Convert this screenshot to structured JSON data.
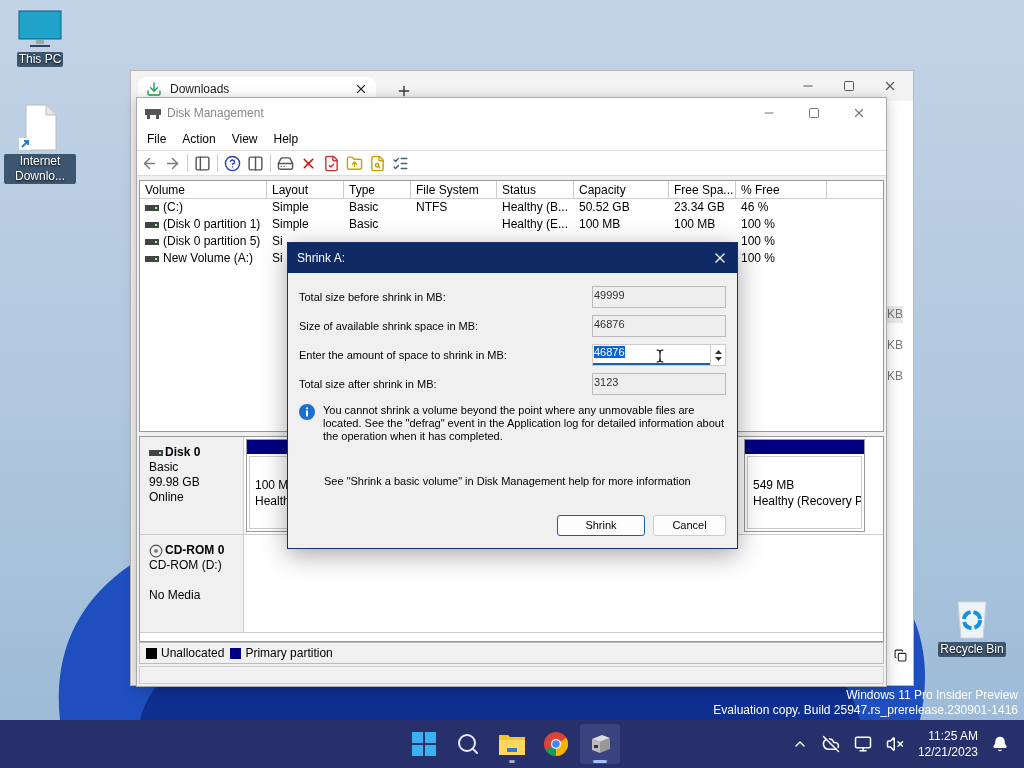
{
  "desktop_icons": [
    {
      "kind": "pc",
      "label": "This PC"
    },
    {
      "kind": "shortcut",
      "label": "Internet Downlo..."
    },
    {
      "kind": "bin",
      "label": "Recycle Bin"
    }
  ],
  "browser": {
    "tab": {
      "title": "Downloads",
      "selected": true
    },
    "side_texts": [
      "KB",
      "KB",
      "KB"
    ]
  },
  "disk_management": {
    "title": "Disk Management",
    "menu": [
      "File",
      "Action",
      "View",
      "Help"
    ],
    "columns": [
      "Volume",
      "Layout",
      "Type",
      "File System",
      "Status",
      "Capacity",
      "Free Spa...",
      "% Free"
    ],
    "rows": [
      {
        "cells": [
          "(C:)",
          "Simple",
          "Basic",
          "NTFS",
          "Healthy (B...",
          "50.52 GB",
          "23.34 GB",
          "46 %"
        ]
      },
      {
        "cells": [
          "(Disk 0 partition 1)",
          "Simple",
          "Basic",
          null,
          "Healthy (E...",
          "100 MB",
          "100 MB",
          "100 %"
        ]
      },
      {
        "cells": [
          "(Disk 0 partition 5)",
          "Si",
          null,
          null,
          null,
          null,
          null,
          "100 %"
        ]
      },
      {
        "cells": [
          "New Volume (A:)",
          "Si",
          null,
          null,
          null,
          null,
          null,
          "100 %"
        ]
      }
    ],
    "disks": [
      {
        "kind": "disk",
        "name": "Disk 0",
        "lines": [
          "Basic",
          "99.98 GB",
          "Online"
        ],
        "partitions": [
          {
            "size": "100 M",
            "status": "Health"
          },
          {
            "size": "549 MB",
            "status": "Healthy (Recovery P"
          }
        ]
      },
      {
        "kind": "cdrom",
        "name": "CD-ROM 0",
        "lines": [
          "CD-ROM (D:)",
          "No Media"
        ]
      }
    ],
    "legend": [
      {
        "label": "Unallocated",
        "color": "#000000"
      },
      {
        "label": "Primary partition",
        "color": "#000080"
      }
    ]
  },
  "dialog": {
    "title": "Shrink A:",
    "fields": [
      {
        "kind": "readonly",
        "label": "Total size before shrink in MB:",
        "value": "49999"
      },
      {
        "kind": "readonly",
        "label": "Size of available shrink space in MB:",
        "value": "46876"
      },
      {
        "kind": "spin",
        "label": "Enter the amount of space to shrink in MB:",
        "value": "46876",
        "selected": true
      },
      {
        "kind": "readonly",
        "label": "Total size after shrink in MB:",
        "value": "3123"
      }
    ],
    "info": "You cannot shrink a volume beyond the point where any unmovable files are located. See the \"defrag\" event in the Application log for detailed information about the operation when it has completed.",
    "help": "See \"Shrink a basic volume\" in Disk Management help for more information",
    "buttons": [
      {
        "label": "Shrink",
        "default": true
      },
      {
        "label": "Cancel",
        "default": false
      }
    ]
  },
  "watermark": [
    "Windows 11 Pro Insider Preview",
    "Evaluation copy. Build 25947.rs_prerelease.230901-1416"
  ],
  "taskbar": {
    "apps": [
      {
        "kind": "start",
        "running": false,
        "selected": false
      },
      {
        "kind": "search",
        "running": false,
        "selected": false
      },
      {
        "kind": "explorer",
        "running": true,
        "selected": false
      },
      {
        "kind": "chrome",
        "running": false,
        "selected": false
      },
      {
        "kind": "diskmgmt",
        "running": true,
        "selected": true
      }
    ],
    "time": "11:25 AM",
    "date": "12/21/2023"
  }
}
